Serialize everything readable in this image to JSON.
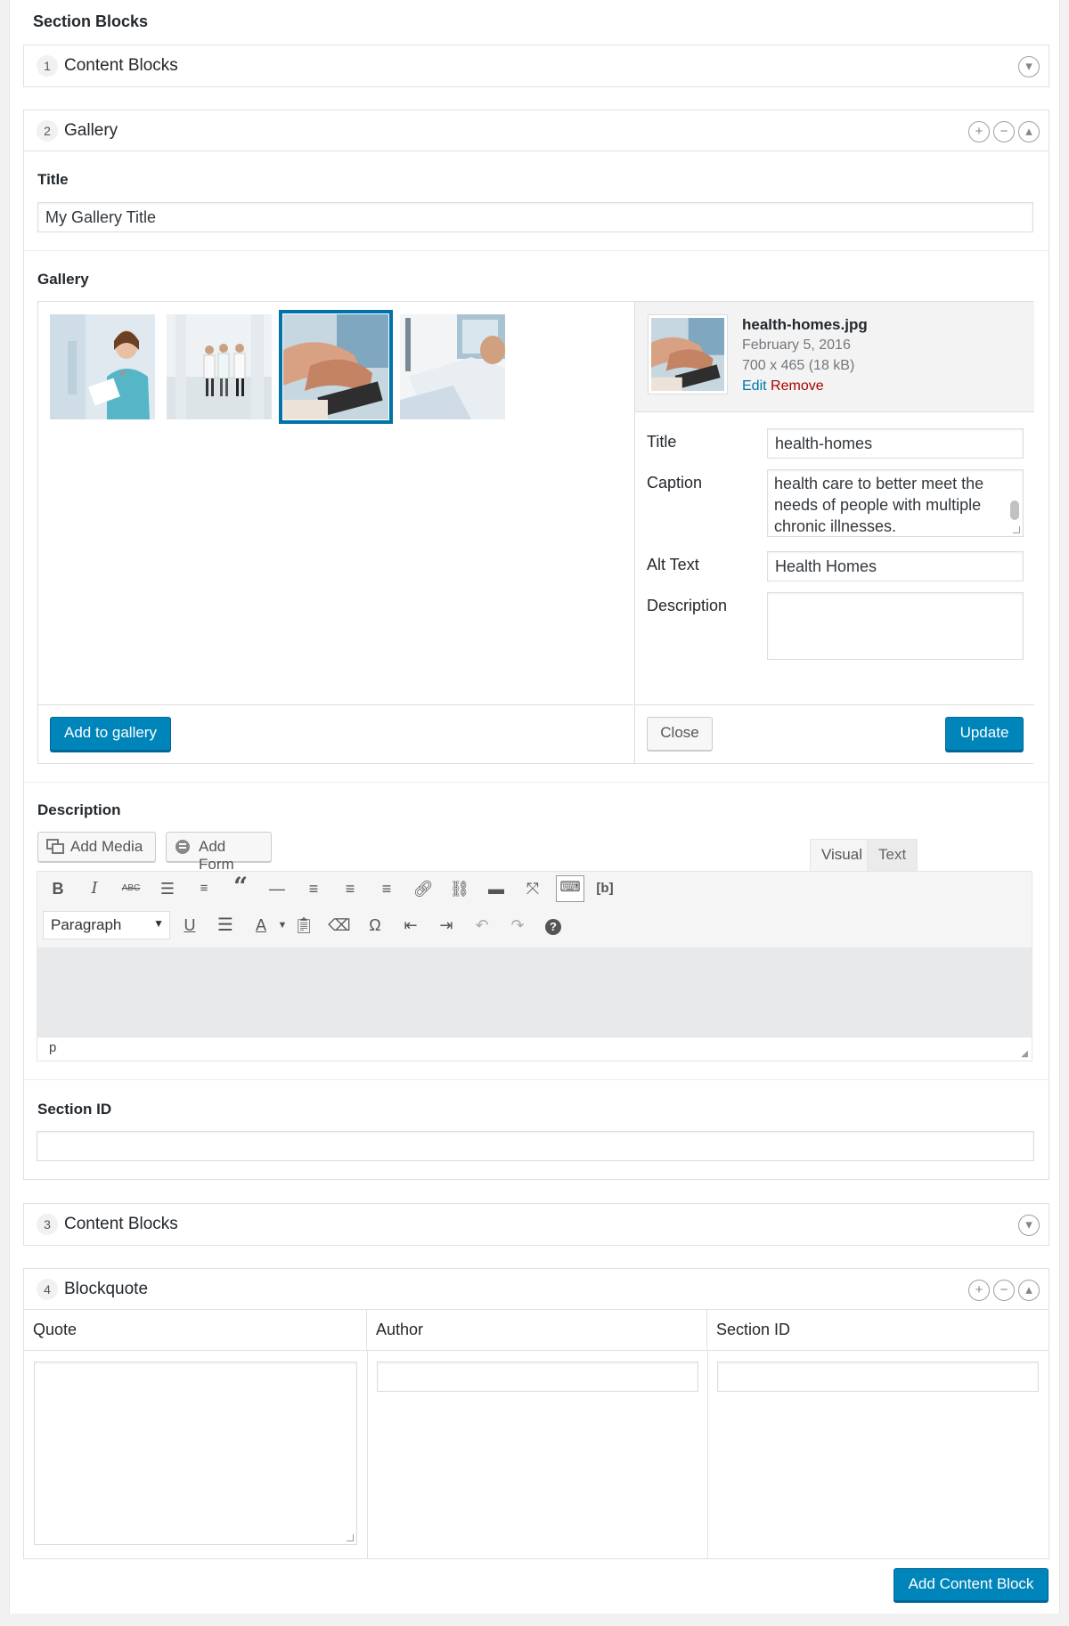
{
  "page": {
    "section_label": "Section Blocks"
  },
  "layouts": {
    "l1": {
      "num": "1",
      "title": "Content Blocks"
    },
    "l2": {
      "num": "2",
      "title": "Gallery",
      "title_field": {
        "label": "Title",
        "value": "My Gallery Title"
      },
      "gallery_field": {
        "label": "Gallery"
      },
      "gallery": {
        "thumbs": [
          "nurse-image",
          "doctors-hallway-image",
          "health-homes-image",
          "patient-bed-image"
        ],
        "selected_index": 2,
        "add_button": "Add to gallery",
        "side": {
          "filename": "health-homes.jpg",
          "date": "February 5, 2016",
          "dimensions": "700 x 465 (18 kB)",
          "edit": "Edit",
          "remove": "Remove",
          "title_label": "Title",
          "title_value": "health-homes",
          "caption_label": "Caption",
          "caption_value": "health care to better meet the needs of people with multiple chronic illnesses.",
          "alt_label": "Alt Text",
          "alt_value": "Health Homes",
          "desc_label": "Description",
          "desc_value": "",
          "close_button": "Close",
          "update_button": "Update"
        }
      },
      "description_field": {
        "label": "Description",
        "add_media": "Add Media",
        "add_form": "Add Form",
        "tab_visual": "Visual",
        "tab_text": "Text",
        "format_select": "Paragraph",
        "status_path": "p"
      },
      "section_id_field": {
        "label": "Section ID",
        "value": ""
      }
    },
    "l3": {
      "num": "3",
      "title": "Content Blocks"
    },
    "l4": {
      "num": "4",
      "title": "Blockquote",
      "columns": [
        "Quote",
        "Author",
        "Section ID"
      ]
    }
  },
  "footer": {
    "add_block_button": "Add Content Block"
  },
  "colors": {
    "primary": "#0085ba",
    "remove": "#a00",
    "link": "#0073aa",
    "selected_outline": "#0073aa"
  }
}
